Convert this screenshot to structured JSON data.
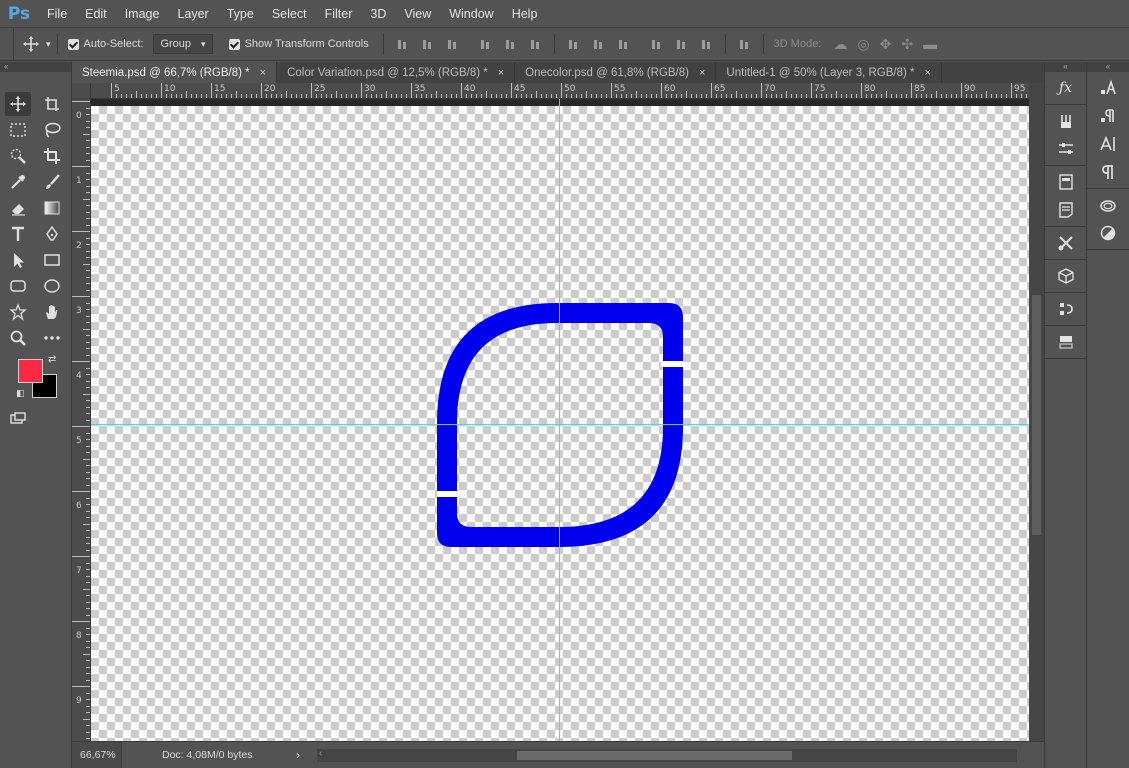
{
  "app": {
    "logo": "Ps"
  },
  "menu": [
    "File",
    "Edit",
    "Image",
    "Layer",
    "Type",
    "Select",
    "Filter",
    "3D",
    "View",
    "Window",
    "Help"
  ],
  "options": {
    "auto_select_label": "Auto-Select:",
    "auto_select_value": "Group",
    "show_transform_label": "Show Transform Controls",
    "three_d_mode_label": "3D Mode:"
  },
  "tabs": [
    {
      "label": "Steemia.psd @ 66,7% (RGB/8) *",
      "close": "×",
      "active": true
    },
    {
      "label": "Color Variation.psd @ 12,5% (RGB/8) *",
      "close": "×",
      "active": false
    },
    {
      "label": "Onecolor.psd @ 61,8% (RGB/8)",
      "close": "×",
      "active": false
    },
    {
      "label": "Untitled-1 @ 50% (Layer 3, RGB/8) *",
      "close": "×",
      "active": false
    }
  ],
  "ruler_top_labels": [
    "5",
    "10",
    "15",
    "20",
    "25",
    "30",
    "35",
    "40",
    "45",
    "50",
    "55",
    "60",
    "65",
    "70",
    "75",
    "80",
    "85",
    "90",
    "95"
  ],
  "ruler_left_labels": [
    "0",
    "1",
    "2",
    "3",
    "4",
    "5",
    "6",
    "7",
    "8",
    "9"
  ],
  "colors": {
    "foreground": "#ff2845",
    "background": "#000000",
    "shape": "#0000ee",
    "guide": "#2ee6e6"
  },
  "status": {
    "zoom": "66,67%",
    "doc": "Doc: 4,08M/0 bytes",
    "arrow": "›"
  },
  "toolbar": {
    "collapse": "«",
    "tools": [
      "move-tool",
      "artboard-tool",
      "marquee-tool",
      "lasso-tool",
      "quick-select-tool",
      "crop-tool",
      "eyedropper-tool",
      "brush-tool",
      "eraser-tool",
      "gradient-tool",
      "type-tool",
      "pen-tool",
      "path-select-tool",
      "rectangle-tool",
      "rounded-rect-tool",
      "ellipse-tool",
      "custom-shape-tool",
      "hand-tool",
      "zoom-tool",
      "more-tools"
    ]
  },
  "panels": {
    "collapse": "«",
    "col1": [
      "fx-styles",
      "adjust-brushes",
      "properties-sliders",
      "history",
      "notes",
      "tools-preset",
      "3d-cube",
      "actions",
      "layer-comps"
    ],
    "col2": [
      "character-styles",
      "paragraph-styles",
      "character",
      "paragraph",
      "libraries",
      "adjustments"
    ]
  }
}
